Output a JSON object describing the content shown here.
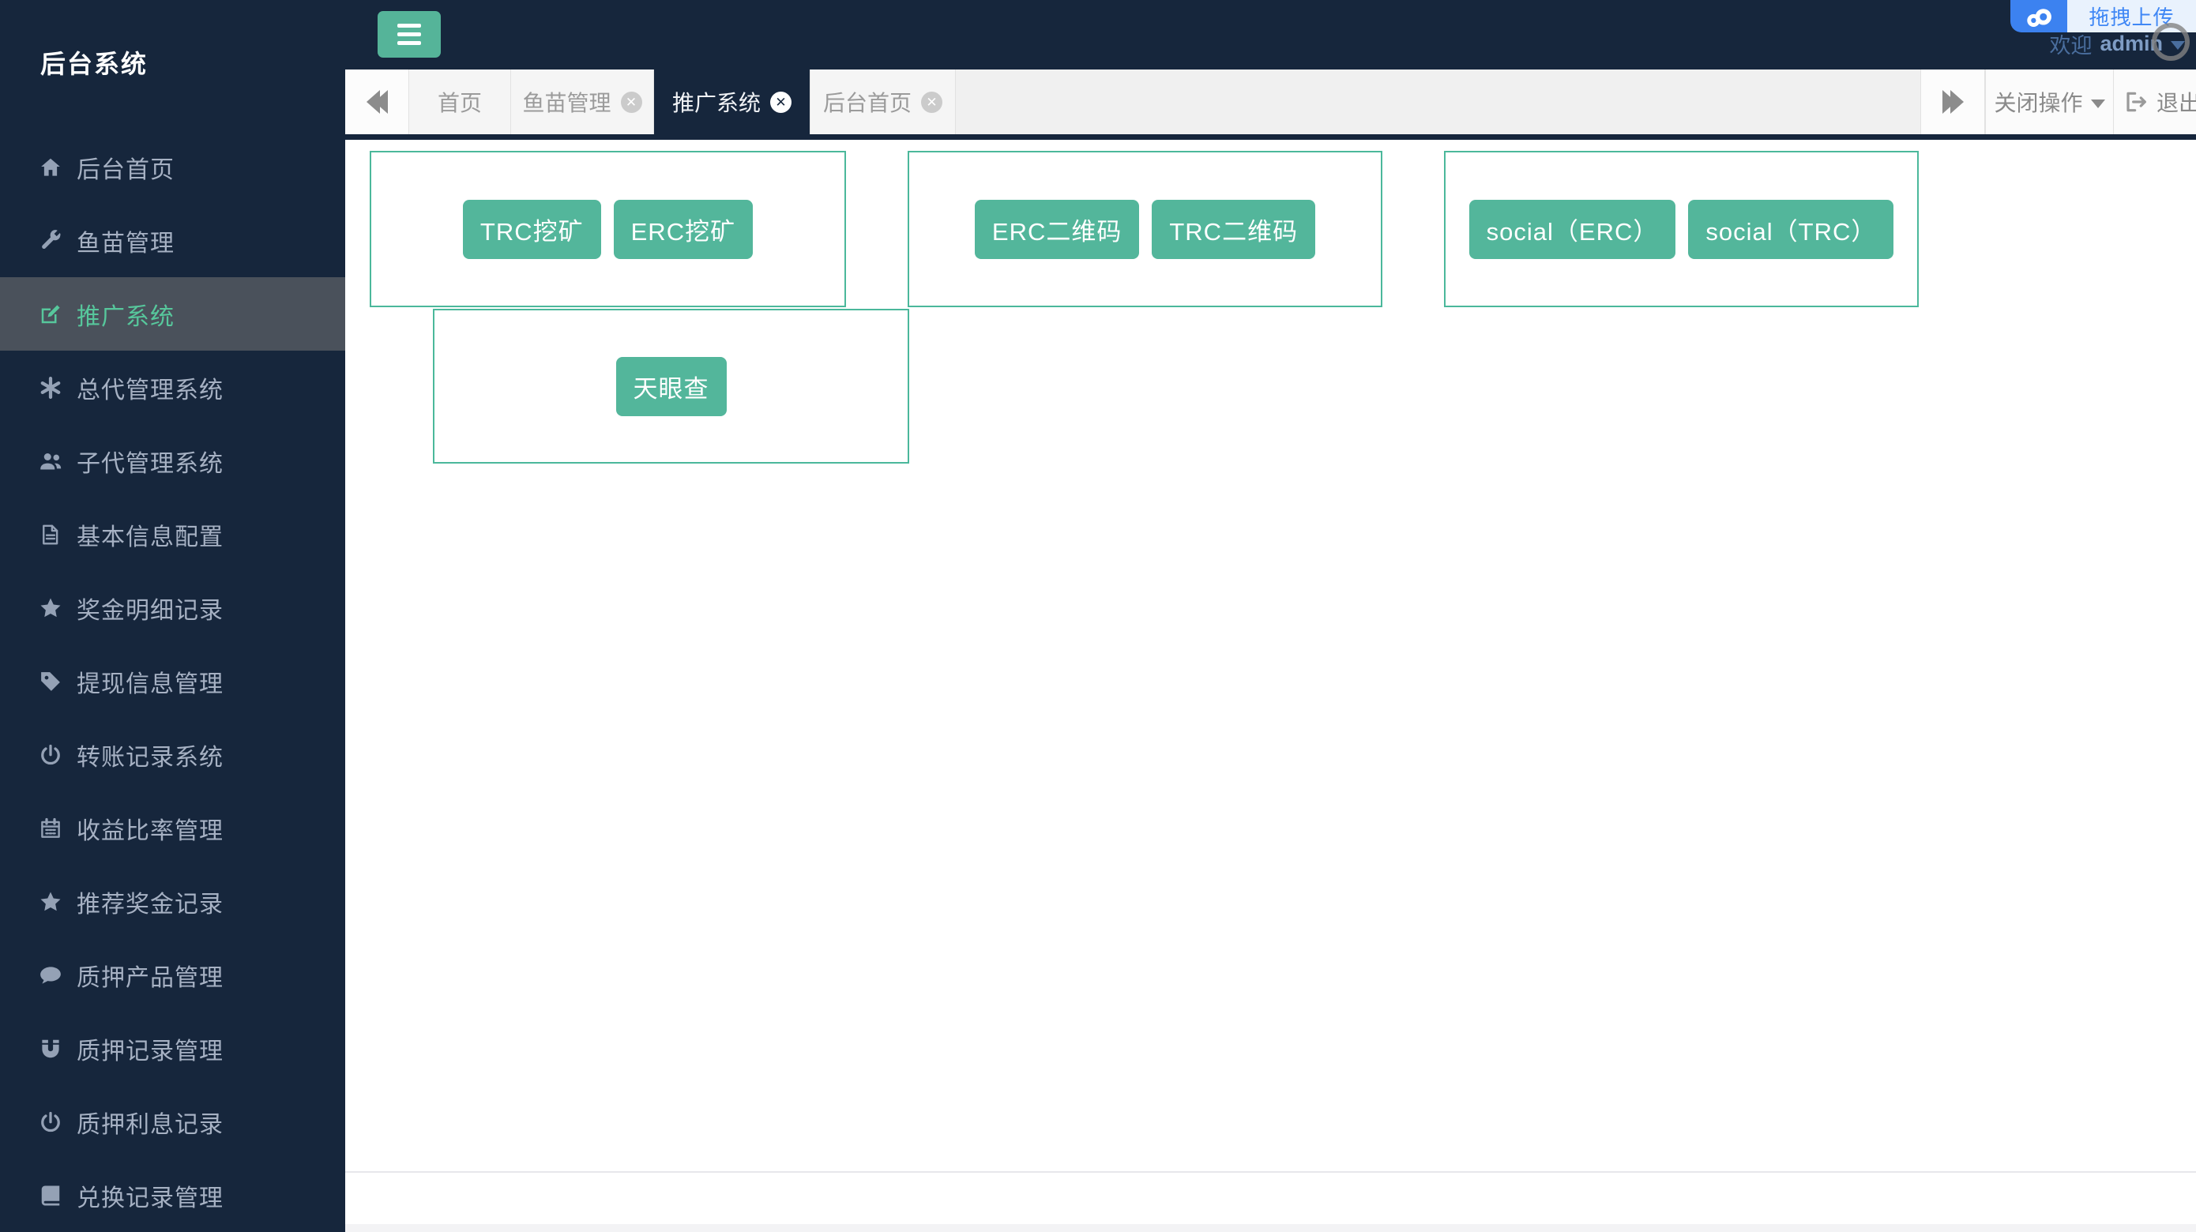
{
  "app": {
    "brand": "后台系统"
  },
  "sidebar": {
    "items": [
      {
        "label": "后台首页",
        "icon": "home-icon",
        "active": false
      },
      {
        "label": "鱼苗管理",
        "icon": "wrench-icon",
        "active": false
      },
      {
        "label": "推广系统",
        "icon": "edit-icon",
        "active": true
      },
      {
        "label": "总代管理系统",
        "icon": "asterisk-icon",
        "active": false
      },
      {
        "label": "子代管理系统",
        "icon": "users-icon",
        "active": false
      },
      {
        "label": "基本信息配置",
        "icon": "file-icon",
        "active": false
      },
      {
        "label": "奖金明细记录",
        "icon": "star-icon",
        "active": false
      },
      {
        "label": "提现信息管理",
        "icon": "tag-icon",
        "active": false
      },
      {
        "label": "转账记录系统",
        "icon": "power-icon",
        "active": false
      },
      {
        "label": "收益比率管理",
        "icon": "calendar-icon",
        "active": false
      },
      {
        "label": "推荐奖金记录",
        "icon": "star-icon",
        "active": false
      },
      {
        "label": "质押产品管理",
        "icon": "comment-icon",
        "active": false
      },
      {
        "label": "质押记录管理",
        "icon": "magnet-icon",
        "active": false
      },
      {
        "label": "质押利息记录",
        "icon": "power-icon",
        "active": false
      },
      {
        "label": "兑换记录管理",
        "icon": "book-icon",
        "active": false
      }
    ]
  },
  "header": {
    "welcome_prefix": "欢迎",
    "username": "admin"
  },
  "upload_overlay": {
    "label": "拖拽上传",
    "icon": "baidu-cloud-icon"
  },
  "tabbar": {
    "tabs": [
      {
        "label": "首页",
        "closable": false,
        "active": false
      },
      {
        "label": "鱼苗管理",
        "closable": true,
        "active": false
      },
      {
        "label": "推广系统",
        "closable": true,
        "active": true
      },
      {
        "label": "后台首页",
        "closable": true,
        "active": false
      }
    ],
    "close_actions_label": "关闭操作",
    "logout_label": "退出"
  },
  "content": {
    "groups": [
      {
        "buttons": [
          "TRC挖矿",
          "ERC挖矿"
        ]
      },
      {
        "buttons": [
          "ERC二维码",
          "TRC二维码"
        ]
      },
      {
        "buttons": [
          "social（ERC）",
          "social（TRC）"
        ]
      },
      {
        "buttons": [
          "天眼查"
        ]
      }
    ]
  },
  "colors": {
    "navy": "#16263C",
    "green_button": "#53B69B",
    "green_border": "#4BB89B",
    "active_item_bg": "#4A515B",
    "active_item_text": "#57C79C",
    "tab_bg": "#F5F5F5",
    "overlay_blue": "#3C82F0",
    "overlay_light": "#E9F2FD"
  }
}
